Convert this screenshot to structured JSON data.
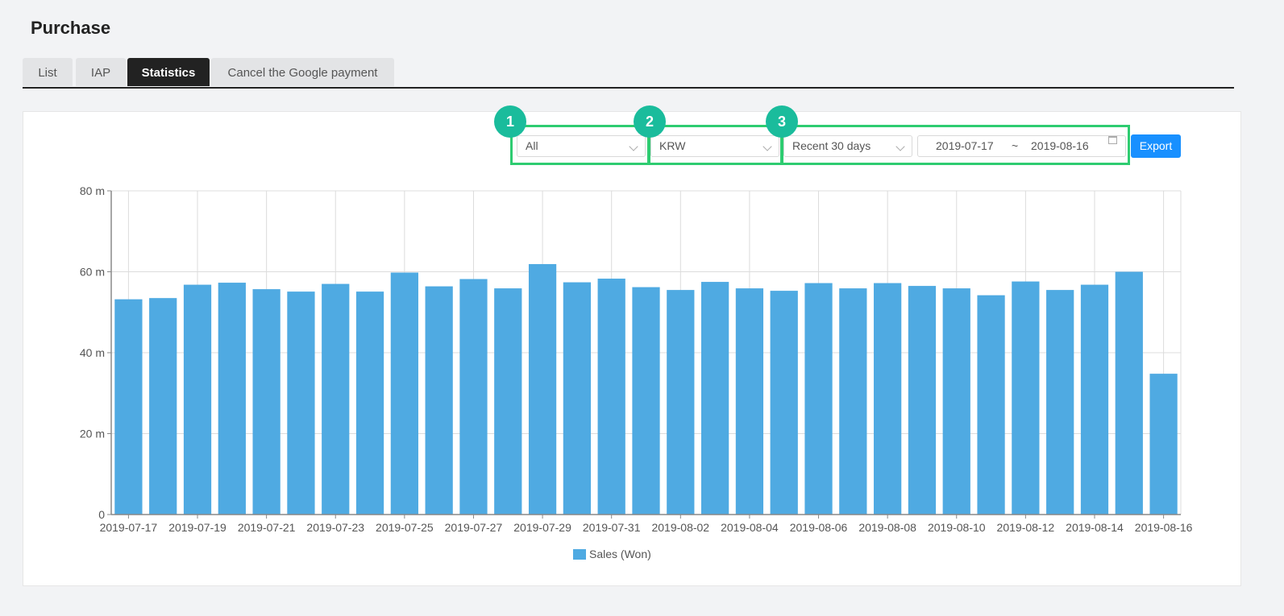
{
  "page": {
    "title": "Purchase"
  },
  "tabs": [
    {
      "label": "List"
    },
    {
      "label": "IAP"
    },
    {
      "label": "Statistics"
    },
    {
      "label": "Cancel the Google payment"
    }
  ],
  "filters": {
    "platform": "All",
    "currency": "KRW",
    "period": "Recent 30 days",
    "date_from": "2019-07-17",
    "date_sep": "~",
    "date_to": "2019-08-16",
    "export_label": "Export"
  },
  "annotations": [
    "1",
    "2",
    "3"
  ],
  "colors": {
    "bar": "#4faae2",
    "highlight": "#2ecc71",
    "badge": "#1abc9c",
    "primary": "#1890ff"
  },
  "chart_data": {
    "type": "bar",
    "categories": [
      "2019-07-17",
      "2019-07-18",
      "2019-07-19",
      "2019-07-20",
      "2019-07-21",
      "2019-07-22",
      "2019-07-23",
      "2019-07-24",
      "2019-07-25",
      "2019-07-26",
      "2019-07-27",
      "2019-07-28",
      "2019-07-29",
      "2019-07-30",
      "2019-07-31",
      "2019-08-01",
      "2019-08-02",
      "2019-08-03",
      "2019-08-04",
      "2019-08-05",
      "2019-08-06",
      "2019-08-07",
      "2019-08-08",
      "2019-08-09",
      "2019-08-10",
      "2019-08-11",
      "2019-08-12",
      "2019-08-13",
      "2019-08-14",
      "2019-08-15",
      "2019-08-16"
    ],
    "tick_labels": [
      "2019-07-17",
      "2019-07-19",
      "2019-07-21",
      "2019-07-23",
      "2019-07-25",
      "2019-07-27",
      "2019-07-29",
      "2019-07-31",
      "2019-08-02",
      "2019-08-04",
      "2019-08-06",
      "2019-08-08",
      "2019-08-10",
      "2019-08-12",
      "2019-08-14",
      "2019-08-16"
    ],
    "series": [
      {
        "name": "Sales (Won)",
        "values": [
          53.2,
          53.5,
          56.8,
          57.3,
          55.7,
          55.1,
          57.0,
          55.1,
          59.8,
          56.4,
          58.2,
          55.9,
          61.9,
          57.4,
          58.3,
          56.2,
          55.5,
          57.5,
          55.9,
          55.3,
          57.2,
          55.9,
          57.2,
          56.5,
          55.9,
          54.2,
          57.6,
          55.5,
          56.8,
          60.0,
          34.8
        ]
      }
    ],
    "ylim": [
      0,
      80
    ],
    "yticks": [
      "0",
      "20 m",
      "40 m",
      "60 m",
      "80 m"
    ],
    "legend": "bottom",
    "grid": true
  }
}
